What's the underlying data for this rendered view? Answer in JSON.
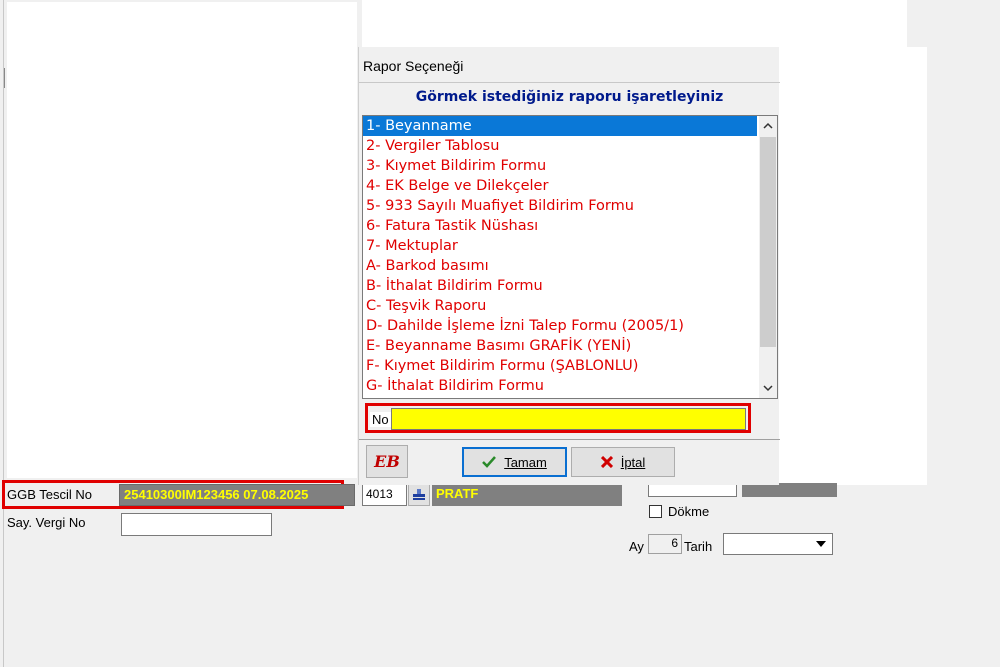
{
  "dialog": {
    "title": "Rapor Seçeneği",
    "header": "Görmek istediğiniz raporu işaretleyiniz",
    "items": [
      "1- Beyanname",
      "2- Vergiler Tablosu",
      "3- Kıymet Bildirim Formu",
      "4- EK Belge ve Dilekçeler",
      "5- 933 Sayılı Muafiyet Bildirim Formu",
      "6- Fatura Tastik Nüshası",
      "7- Mektuplar",
      "A- Barkod basımı",
      "B- İthalat Bildirim Formu",
      "C- Teşvik Raporu",
      "D- Dahilde İşleme İzni Talep Formu (2005/1)",
      "E- Beyanname Basımı GRAFİK (YENİ)",
      "F- Kıymet Bildirim Formu (ŞABLONLU)",
      "G- İthalat Bildirim Formu"
    ],
    "no_label": "No",
    "no_value": "",
    "ok_label": "Tamam",
    "cancel_label": "İptal",
    "logo_text": "EB"
  },
  "form": {
    "ggb_label": "GGB Tescil No",
    "ggb_value": "25410300IM123456 07.08.2025",
    "vergi_label": "Say. Vergi No",
    "vergi_value": "",
    "code_value": "4013",
    "pratf_label": "PRATF",
    "dokme_label": "Dökme",
    "ay_label": "Ay",
    "ay_value": "6",
    "tarih_label": "Tarih",
    "tarih_value": ""
  },
  "colors": {
    "accent_red": "#e00000",
    "selection_blue": "#0a78d7",
    "highlight_yellow": "#ffff00",
    "header_blue": "#001a8c"
  }
}
